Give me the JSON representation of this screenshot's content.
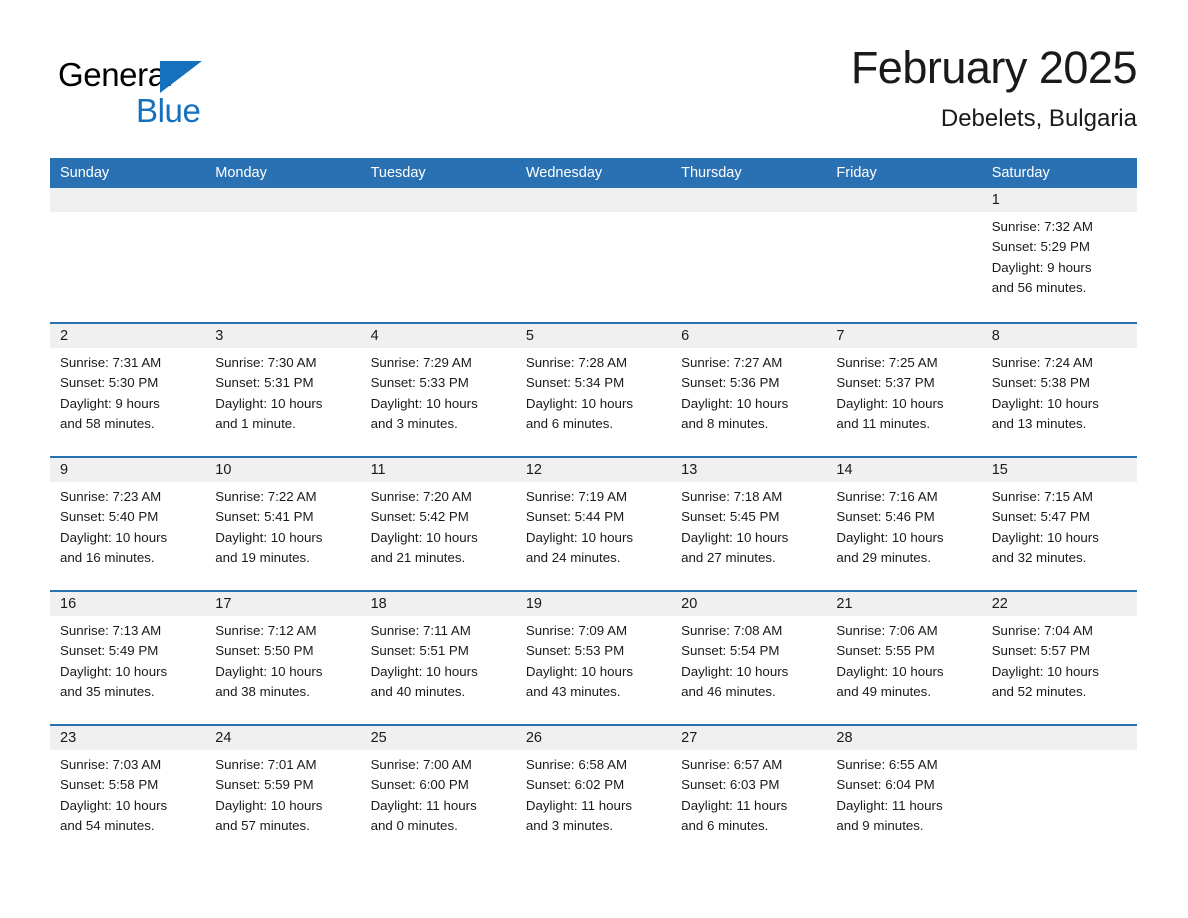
{
  "logo": {
    "word_top": "General",
    "word_bottom": "Blue",
    "triangle_icon": "triangle-icon",
    "accent_color": "#1570bd"
  },
  "header": {
    "title": "February 2025",
    "location": "Debelets, Bulgaria"
  },
  "theme": {
    "header_blue": "#2a71b4",
    "daynum_band": "#f0f0f0",
    "text": "#1a1a1a"
  },
  "weekdays": [
    "Sunday",
    "Monday",
    "Tuesday",
    "Wednesday",
    "Thursday",
    "Friday",
    "Saturday"
  ],
  "weeks": [
    [
      {
        "day": "",
        "sunrise": "",
        "sunset": "",
        "daylight": "",
        "daylight2": "",
        "empty": true
      },
      {
        "day": "",
        "sunrise": "",
        "sunset": "",
        "daylight": "",
        "daylight2": "",
        "empty": true
      },
      {
        "day": "",
        "sunrise": "",
        "sunset": "",
        "daylight": "",
        "daylight2": "",
        "empty": true
      },
      {
        "day": "",
        "sunrise": "",
        "sunset": "",
        "daylight": "",
        "daylight2": "",
        "empty": true
      },
      {
        "day": "",
        "sunrise": "",
        "sunset": "",
        "daylight": "",
        "daylight2": "",
        "empty": true
      },
      {
        "day": "",
        "sunrise": "",
        "sunset": "",
        "daylight": "",
        "daylight2": "",
        "empty": true
      },
      {
        "day": "1",
        "sunrise": "Sunrise: 7:32 AM",
        "sunset": "Sunset: 5:29 PM",
        "daylight": "Daylight: 9 hours",
        "daylight2": "and 56 minutes."
      }
    ],
    [
      {
        "day": "2",
        "sunrise": "Sunrise: 7:31 AM",
        "sunset": "Sunset: 5:30 PM",
        "daylight": "Daylight: 9 hours",
        "daylight2": "and 58 minutes."
      },
      {
        "day": "3",
        "sunrise": "Sunrise: 7:30 AM",
        "sunset": "Sunset: 5:31 PM",
        "daylight": "Daylight: 10 hours",
        "daylight2": "and 1 minute."
      },
      {
        "day": "4",
        "sunrise": "Sunrise: 7:29 AM",
        "sunset": "Sunset: 5:33 PM",
        "daylight": "Daylight: 10 hours",
        "daylight2": "and 3 minutes."
      },
      {
        "day": "5",
        "sunrise": "Sunrise: 7:28 AM",
        "sunset": "Sunset: 5:34 PM",
        "daylight": "Daylight: 10 hours",
        "daylight2": "and 6 minutes."
      },
      {
        "day": "6",
        "sunrise": "Sunrise: 7:27 AM",
        "sunset": "Sunset: 5:36 PM",
        "daylight": "Daylight: 10 hours",
        "daylight2": "and 8 minutes."
      },
      {
        "day": "7",
        "sunrise": "Sunrise: 7:25 AM",
        "sunset": "Sunset: 5:37 PM",
        "daylight": "Daylight: 10 hours",
        "daylight2": "and 11 minutes."
      },
      {
        "day": "8",
        "sunrise": "Sunrise: 7:24 AM",
        "sunset": "Sunset: 5:38 PM",
        "daylight": "Daylight: 10 hours",
        "daylight2": "and 13 minutes."
      }
    ],
    [
      {
        "day": "9",
        "sunrise": "Sunrise: 7:23 AM",
        "sunset": "Sunset: 5:40 PM",
        "daylight": "Daylight: 10 hours",
        "daylight2": "and 16 minutes."
      },
      {
        "day": "10",
        "sunrise": "Sunrise: 7:22 AM",
        "sunset": "Sunset: 5:41 PM",
        "daylight": "Daylight: 10 hours",
        "daylight2": "and 19 minutes."
      },
      {
        "day": "11",
        "sunrise": "Sunrise: 7:20 AM",
        "sunset": "Sunset: 5:42 PM",
        "daylight": "Daylight: 10 hours",
        "daylight2": "and 21 minutes."
      },
      {
        "day": "12",
        "sunrise": "Sunrise: 7:19 AM",
        "sunset": "Sunset: 5:44 PM",
        "daylight": "Daylight: 10 hours",
        "daylight2": "and 24 minutes."
      },
      {
        "day": "13",
        "sunrise": "Sunrise: 7:18 AM",
        "sunset": "Sunset: 5:45 PM",
        "daylight": "Daylight: 10 hours",
        "daylight2": "and 27 minutes."
      },
      {
        "day": "14",
        "sunrise": "Sunrise: 7:16 AM",
        "sunset": "Sunset: 5:46 PM",
        "daylight": "Daylight: 10 hours",
        "daylight2": "and 29 minutes."
      },
      {
        "day": "15",
        "sunrise": "Sunrise: 7:15 AM",
        "sunset": "Sunset: 5:47 PM",
        "daylight": "Daylight: 10 hours",
        "daylight2": "and 32 minutes."
      }
    ],
    [
      {
        "day": "16",
        "sunrise": "Sunrise: 7:13 AM",
        "sunset": "Sunset: 5:49 PM",
        "daylight": "Daylight: 10 hours",
        "daylight2": "and 35 minutes."
      },
      {
        "day": "17",
        "sunrise": "Sunrise: 7:12 AM",
        "sunset": "Sunset: 5:50 PM",
        "daylight": "Daylight: 10 hours",
        "daylight2": "and 38 minutes."
      },
      {
        "day": "18",
        "sunrise": "Sunrise: 7:11 AM",
        "sunset": "Sunset: 5:51 PM",
        "daylight": "Daylight: 10 hours",
        "daylight2": "and 40 minutes."
      },
      {
        "day": "19",
        "sunrise": "Sunrise: 7:09 AM",
        "sunset": "Sunset: 5:53 PM",
        "daylight": "Daylight: 10 hours",
        "daylight2": "and 43 minutes."
      },
      {
        "day": "20",
        "sunrise": "Sunrise: 7:08 AM",
        "sunset": "Sunset: 5:54 PM",
        "daylight": "Daylight: 10 hours",
        "daylight2": "and 46 minutes."
      },
      {
        "day": "21",
        "sunrise": "Sunrise: 7:06 AM",
        "sunset": "Sunset: 5:55 PM",
        "daylight": "Daylight: 10 hours",
        "daylight2": "and 49 minutes."
      },
      {
        "day": "22",
        "sunrise": "Sunrise: 7:04 AM",
        "sunset": "Sunset: 5:57 PM",
        "daylight": "Daylight: 10 hours",
        "daylight2": "and 52 minutes."
      }
    ],
    [
      {
        "day": "23",
        "sunrise": "Sunrise: 7:03 AM",
        "sunset": "Sunset: 5:58 PM",
        "daylight": "Daylight: 10 hours",
        "daylight2": "and 54 minutes."
      },
      {
        "day": "24",
        "sunrise": "Sunrise: 7:01 AM",
        "sunset": "Sunset: 5:59 PM",
        "daylight": "Daylight: 10 hours",
        "daylight2": "and 57 minutes."
      },
      {
        "day": "25",
        "sunrise": "Sunrise: 7:00 AM",
        "sunset": "Sunset: 6:00 PM",
        "daylight": "Daylight: 11 hours",
        "daylight2": "and 0 minutes."
      },
      {
        "day": "26",
        "sunrise": "Sunrise: 6:58 AM",
        "sunset": "Sunset: 6:02 PM",
        "daylight": "Daylight: 11 hours",
        "daylight2": "and 3 minutes."
      },
      {
        "day": "27",
        "sunrise": "Sunrise: 6:57 AM",
        "sunset": "Sunset: 6:03 PM",
        "daylight": "Daylight: 11 hours",
        "daylight2": "and 6 minutes."
      },
      {
        "day": "28",
        "sunrise": "Sunrise: 6:55 AM",
        "sunset": "Sunset: 6:04 PM",
        "daylight": "Daylight: 11 hours",
        "daylight2": "and 9 minutes."
      },
      {
        "day": "",
        "sunrise": "",
        "sunset": "",
        "daylight": "",
        "daylight2": "",
        "empty": true
      }
    ]
  ]
}
